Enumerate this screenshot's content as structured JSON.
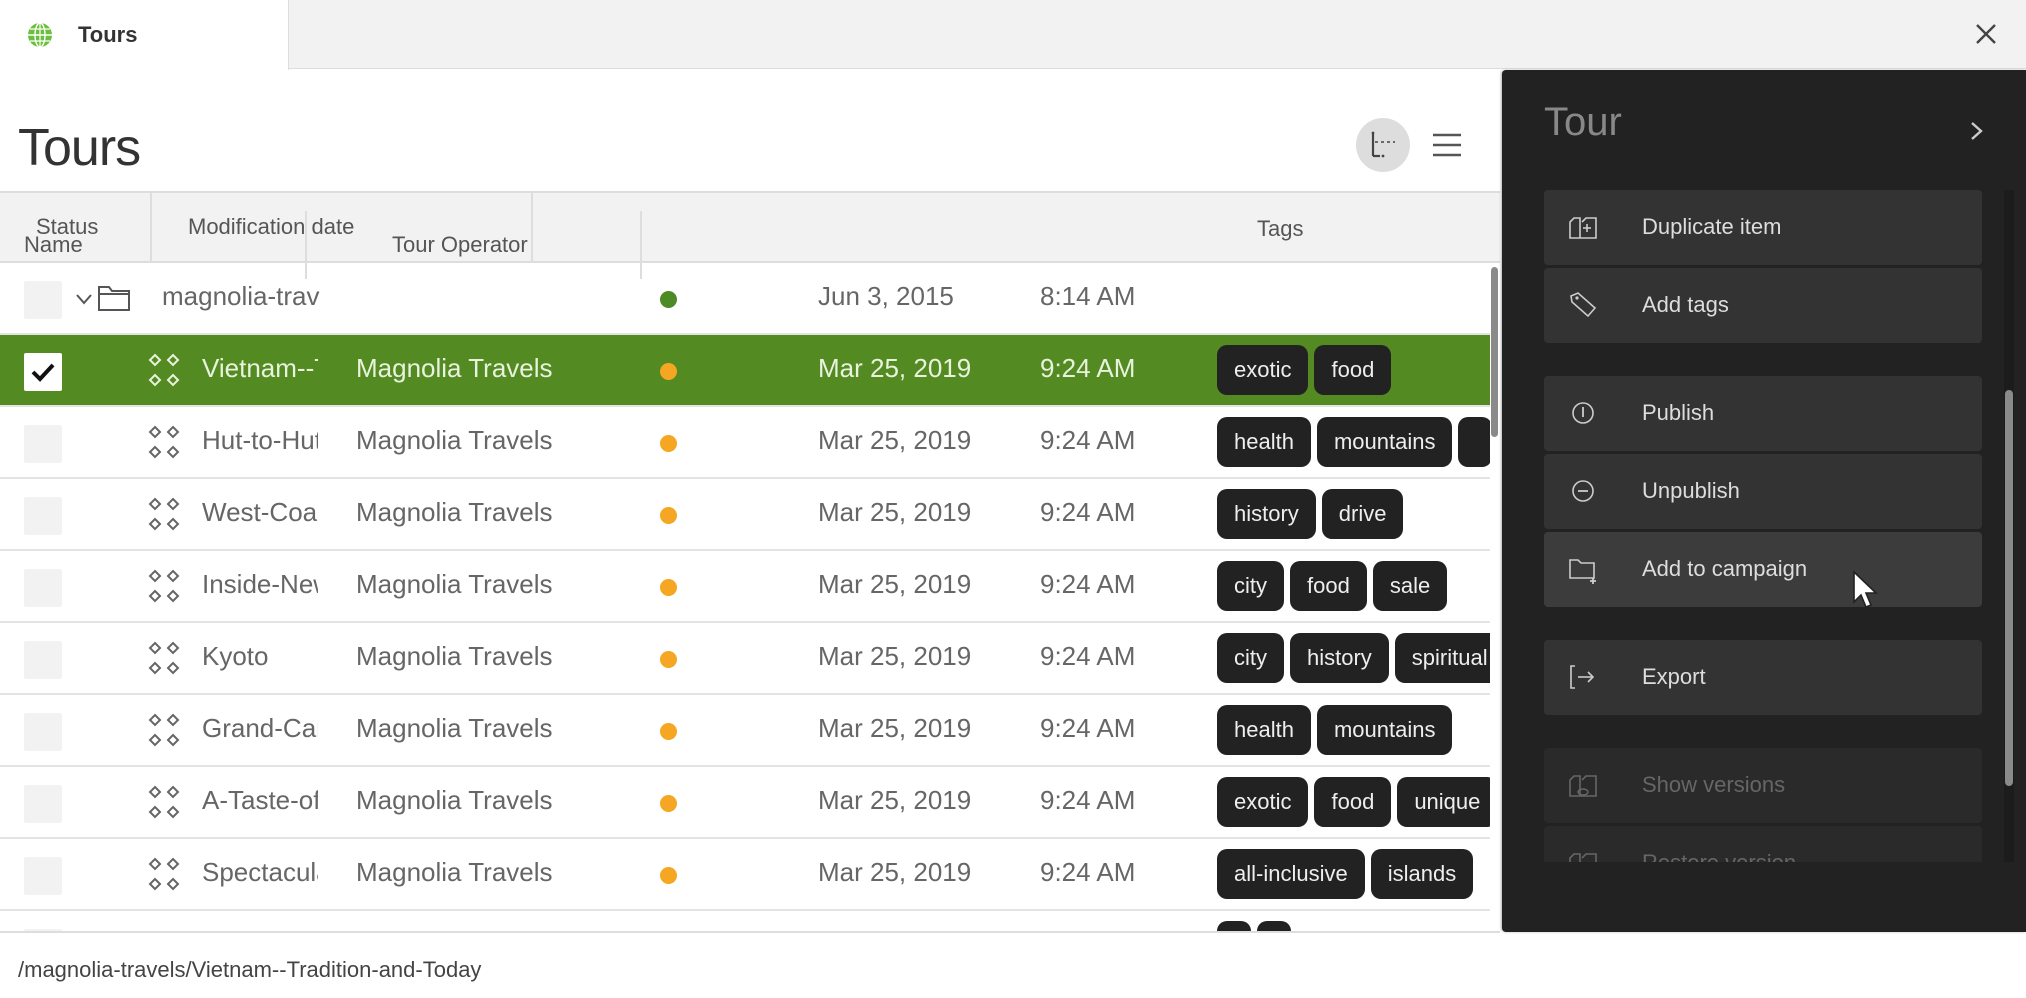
{
  "tab": {
    "label": "Tours",
    "icon": "globe-icon"
  },
  "page": {
    "title": "Tours"
  },
  "toolbar": {
    "view_toggle_icon": "tree-view-icon",
    "menu_icon": "hamburger-menu-icon"
  },
  "grid": {
    "columns": [
      "Name",
      "Tour Operator",
      "Status",
      "Modification date",
      "Tags"
    ],
    "folder_row": {
      "name": "magnolia-travels",
      "name_display": "magnolia-trav",
      "status": "published",
      "status_color": "#4e8a25",
      "date": "Jun 3, 2015",
      "time": "8:14 AM"
    },
    "rows": [
      {
        "name": "Vietnam--Tradition-and-Today",
        "name_display": "Vietnam--T",
        "operator": "Magnolia Travels",
        "status": "modified",
        "date": "Mar 25, 2019",
        "time": "9:24 AM",
        "tags": [
          "exotic",
          "food"
        ],
        "selected": true
      },
      {
        "name": "Hut-to-Hut",
        "name_display": "Hut-to-Hut",
        "operator": "Magnolia Travels",
        "status": "modified",
        "date": "Mar 25, 2019",
        "time": "9:24 AM",
        "tags": [
          "health",
          "mountains",
          ""
        ],
        "selected": false
      },
      {
        "name": "West-Coast",
        "name_display": "West-Coast",
        "operator": "Magnolia Travels",
        "status": "modified",
        "date": "Mar 25, 2019",
        "time": "9:24 AM",
        "tags": [
          "history",
          "drive"
        ],
        "selected": false
      },
      {
        "name": "Inside-New",
        "name_display": "Inside-New",
        "operator": "Magnolia Travels",
        "status": "modified",
        "date": "Mar 25, 2019",
        "time": "9:24 AM",
        "tags": [
          "city",
          "food",
          "sale"
        ],
        "selected": false
      },
      {
        "name": "Kyoto",
        "name_display": "Kyoto",
        "operator": "Magnolia Travels",
        "status": "modified",
        "date": "Mar 25, 2019",
        "time": "9:24 AM",
        "tags": [
          "city",
          "history",
          "spiritual"
        ],
        "selected": false
      },
      {
        "name": "Grand-Canyon",
        "name_display": "Grand-Canyon",
        "operator": "Magnolia Travels",
        "status": "modified",
        "date": "Mar 25, 2019",
        "time": "9:24 AM",
        "tags": [
          "health",
          "mountains"
        ],
        "selected": false
      },
      {
        "name": "A-Taste-of",
        "name_display": "A-Taste-of",
        "operator": "Magnolia Travels",
        "status": "modified",
        "date": "Mar 25, 2019",
        "time": "9:24 AM",
        "tags": [
          "exotic",
          "food",
          "unique"
        ],
        "selected": false
      },
      {
        "name": "Spectacular",
        "name_display": "Spectacular",
        "operator": "Magnolia Travels",
        "status": "modified",
        "date": "Mar 25, 2019",
        "time": "9:24 AM",
        "tags": [
          "all-inclusive",
          "islands"
        ],
        "selected": false
      },
      {
        "name": "",
        "name_display": "",
        "operator": "",
        "status": "",
        "date": "",
        "time": "",
        "tags": [
          "      ",
          "            "
        ],
        "selected": false,
        "partial": true
      }
    ],
    "status_colors": {
      "published": "#4e8a25",
      "modified": "#f5a623"
    },
    "selected_color": "#538b22"
  },
  "statusbar": {
    "path": "/magnolia-travels/Vietnam--Tradition-and-Today"
  },
  "panel": {
    "title": "Tour",
    "actions": [
      {
        "label": "Duplicate item",
        "icon": "duplicate-icon",
        "state": "normal"
      },
      {
        "label": "Add tags",
        "icon": "tag-icon",
        "state": "normal"
      },
      {
        "label": "Publish",
        "icon": "publish-icon",
        "state": "normal"
      },
      {
        "label": "Unpublish",
        "icon": "unpublish-icon",
        "state": "normal"
      },
      {
        "label": "Add to campaign",
        "icon": "campaign-folder-icon",
        "state": "hover"
      },
      {
        "label": "Export",
        "icon": "export-icon",
        "state": "normal"
      },
      {
        "label": "Show versions",
        "icon": "show-versions-icon",
        "state": "disabled"
      },
      {
        "label": "Restore version",
        "icon": "restore-version-icon",
        "state": "disabled"
      }
    ]
  }
}
